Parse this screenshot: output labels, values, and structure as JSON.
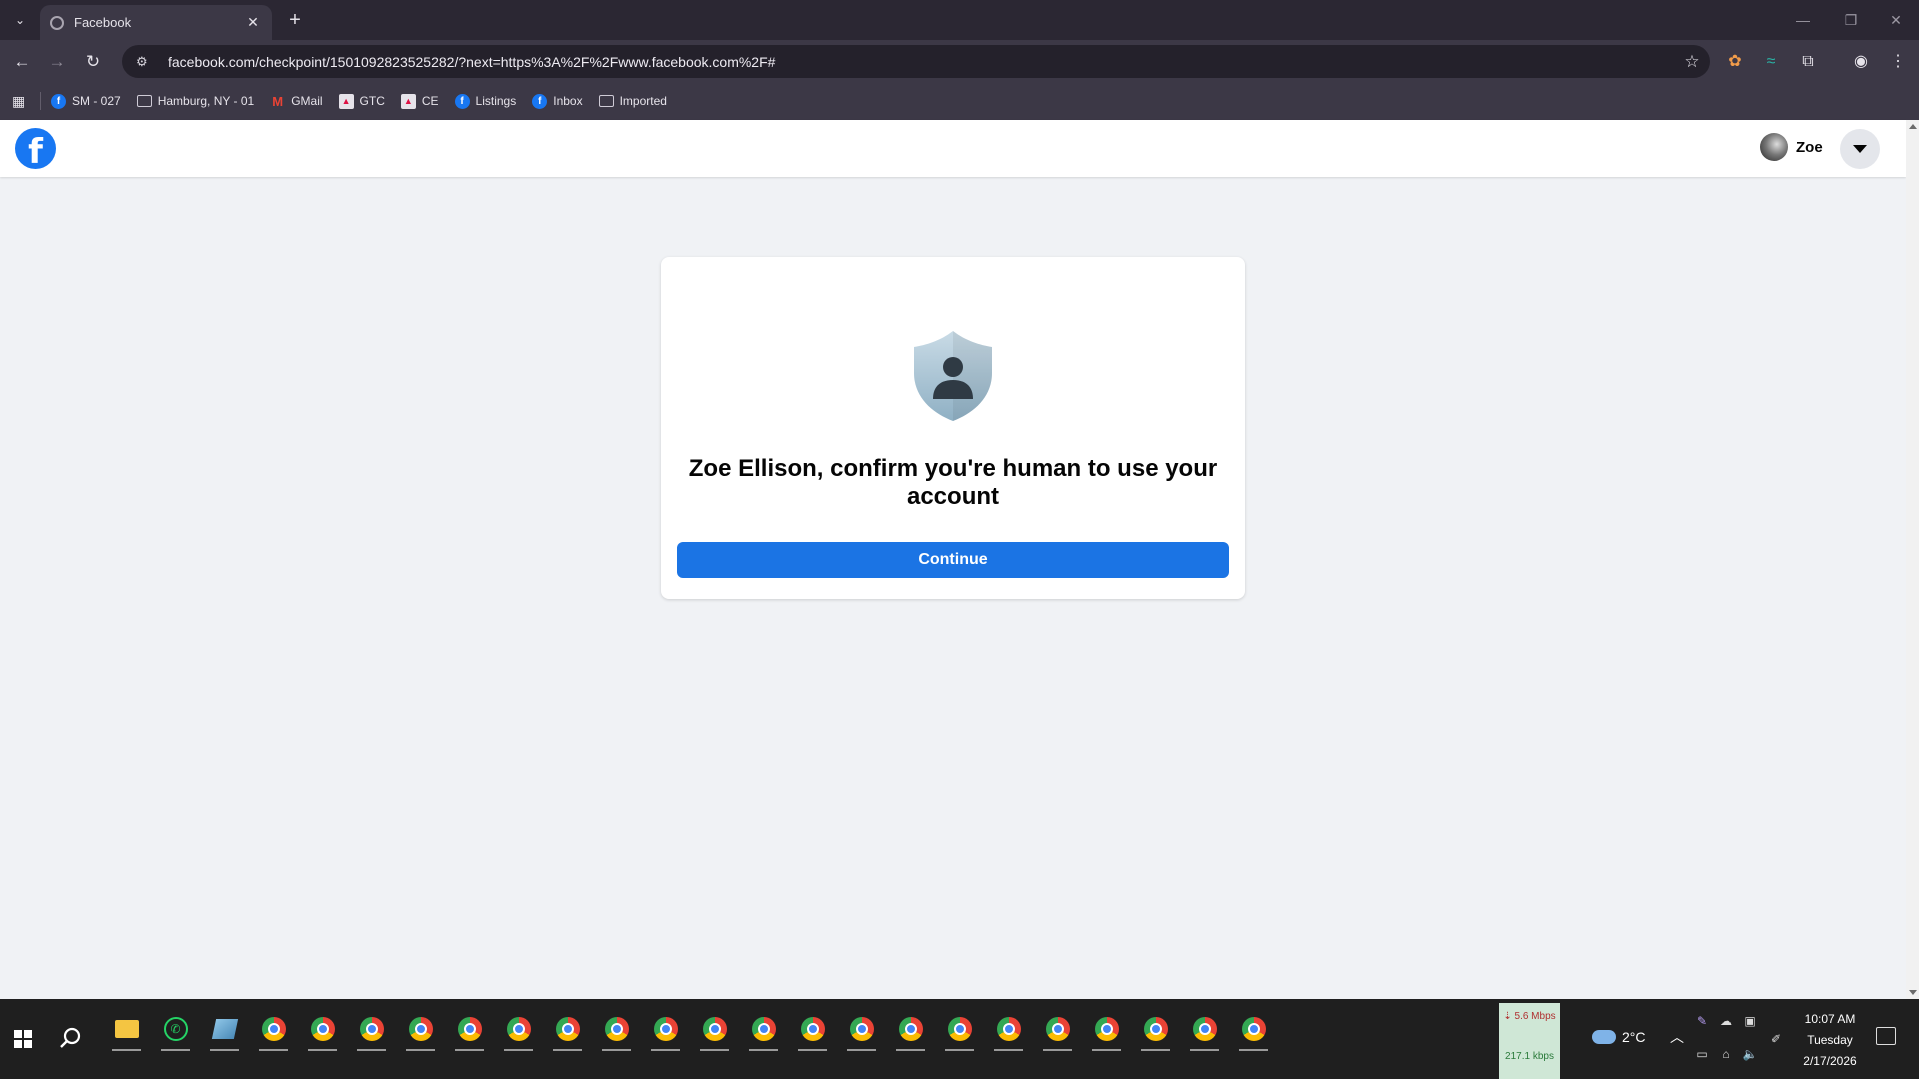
{
  "browser": {
    "tab": {
      "title": "Facebook",
      "close": "✕"
    },
    "new_tab": "+",
    "window_controls": {
      "minimize": "—",
      "restore": "❐",
      "close": "✕"
    },
    "address": {
      "url": "facebook.com/checkpoint/1501092823525282/?next=https%3A%2F%2Fwww.facebook.com%2F#"
    },
    "bookmarks": [
      {
        "label": "SM - 027",
        "icon": "facebook-icon"
      },
      {
        "label": "Hamburg, NY - 01",
        "icon": "folder-icon"
      },
      {
        "label": "GMail",
        "icon": "gmail-icon"
      },
      {
        "label": "GTC",
        "icon": "image-icon"
      },
      {
        "label": "CE",
        "icon": "image-icon"
      },
      {
        "label": "Listings",
        "icon": "facebook-icon"
      },
      {
        "label": "Inbox",
        "icon": "facebook-icon"
      },
      {
        "label": "Imported",
        "icon": "folder-icon"
      }
    ]
  },
  "facebook": {
    "logo": "f",
    "profile_name": "Zoe",
    "card": {
      "title": "Zoe Ellison, confirm you're human to use your account",
      "button": "Continue"
    },
    "colors": {
      "brand": "#1877f2",
      "button": "#1b74e4",
      "background": "#f0f2f5"
    }
  },
  "taskbar": {
    "network": {
      "down": "⇣ 5.6 Mbps",
      "up": "217.1 kbps"
    },
    "weather": "2°C",
    "time": "10:07 AM",
    "day": "Tuesday",
    "date": "2/17/2026"
  }
}
